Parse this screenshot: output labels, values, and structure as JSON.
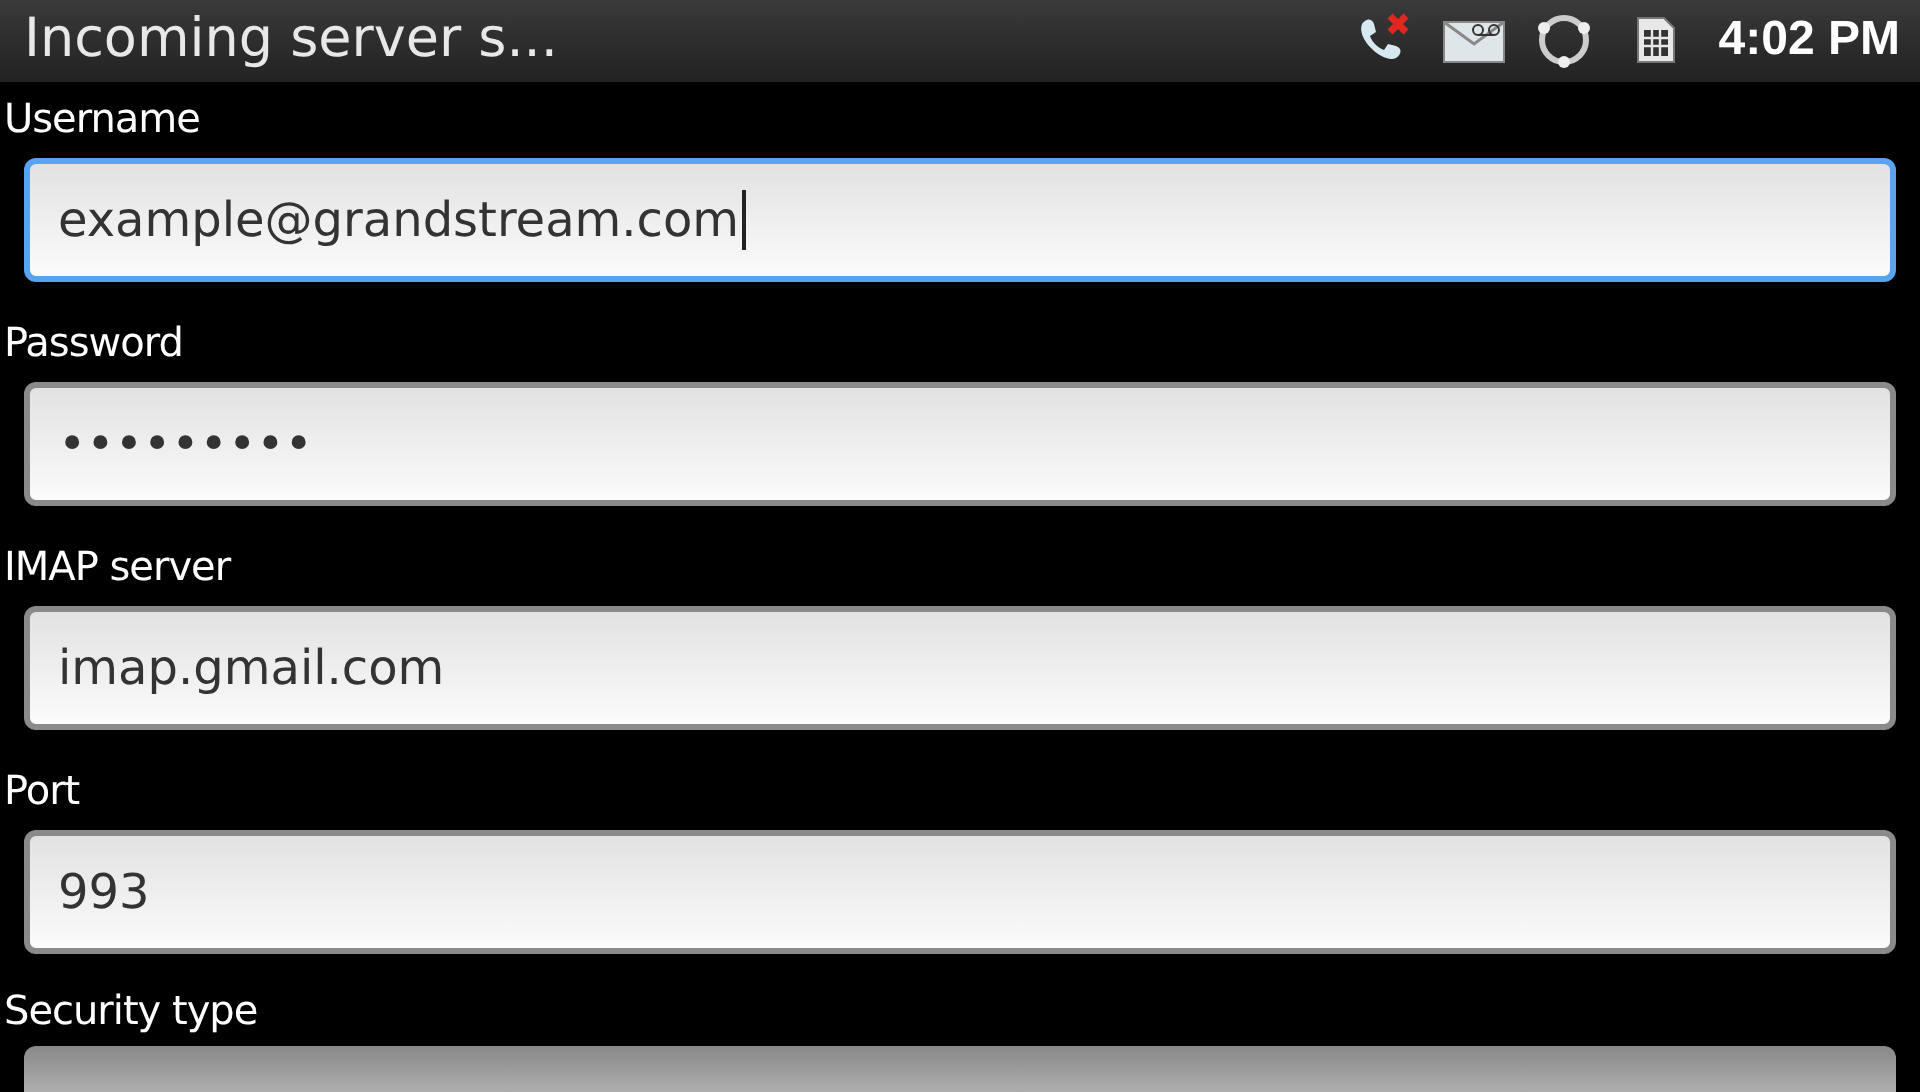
{
  "status_bar": {
    "title": "Incoming server s...",
    "time": "4:02 PM"
  },
  "fields": [
    {
      "label": "Username",
      "value": "example@grandstream.com",
      "focused": true
    },
    {
      "label": "Password",
      "value": "•••••••••",
      "focused": false
    },
    {
      "label": "IMAP server",
      "value": "imap.gmail.com",
      "focused": false
    },
    {
      "label": "Port",
      "value": "993",
      "focused": false
    }
  ],
  "partial_field": {
    "label": "Security type"
  }
}
